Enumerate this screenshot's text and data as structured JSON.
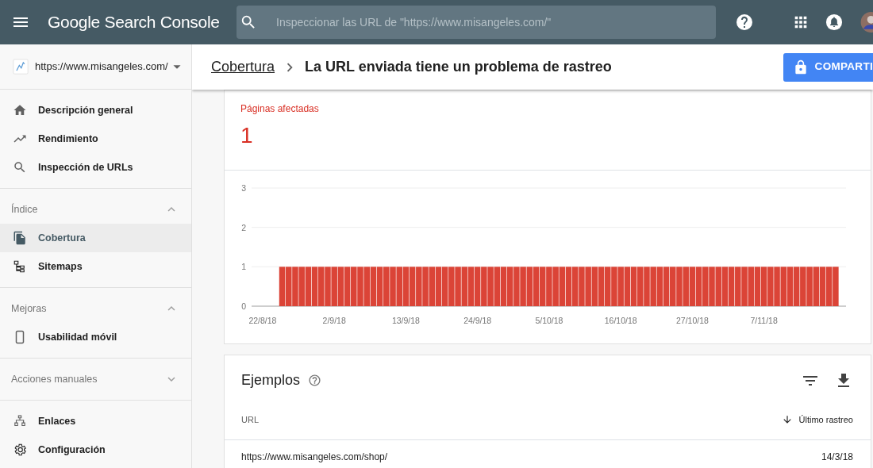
{
  "app": {
    "title": "Google Search Console"
  },
  "search": {
    "placeholder": "Inspeccionar las URL de \"https://www.misangeles.com/\""
  },
  "sidebar": {
    "property": "https://www.misangeles.com/",
    "sections": [
      {
        "items": [
          {
            "label": "Descripción general",
            "selected": false
          },
          {
            "label": "Rendimiento",
            "selected": false
          },
          {
            "label": "Inspección de URLs",
            "selected": false
          }
        ]
      },
      {
        "heading": "Índice",
        "expanded": true,
        "items": [
          {
            "label": "Cobertura",
            "selected": true
          },
          {
            "label": "Sitemaps",
            "selected": false
          }
        ]
      },
      {
        "heading": "Mejoras",
        "expanded": true,
        "items": [
          {
            "label": "Usabilidad móvil",
            "selected": false
          }
        ]
      },
      {
        "heading": "Acciones manuales",
        "expanded": false
      },
      {
        "items": [
          {
            "label": "Enlaces",
            "selected": false
          },
          {
            "label": "Configuración",
            "selected": false
          }
        ]
      }
    ]
  },
  "header": {
    "breadcrumb": "Cobertura",
    "title": "La URL enviada tiene un problema de rastreo",
    "share_button": "COMPARTI"
  },
  "summary": {
    "label": "Páginas afectadas",
    "value": "1",
    "chart_data": {
      "type": "bar",
      "categories": [
        "22/8/18",
        null,
        null,
        null,
        null,
        null,
        null,
        null,
        null,
        null,
        null,
        "2/9/18",
        null,
        null,
        null,
        null,
        null,
        null,
        null,
        null,
        null,
        null,
        "13/9/18",
        null,
        null,
        null,
        null,
        null,
        null,
        null,
        null,
        null,
        null,
        "24/9/18",
        null,
        null,
        null,
        null,
        null,
        null,
        null,
        null,
        null,
        null,
        "5/10/18",
        null,
        null,
        null,
        null,
        null,
        null,
        null,
        null,
        null,
        null,
        "16/10/18",
        null,
        null,
        null,
        null,
        null,
        null,
        null,
        null,
        null,
        null,
        "27/10/18",
        null,
        null,
        null,
        null,
        null,
        null,
        null,
        null,
        null,
        null,
        "7/11/18",
        null,
        null,
        null,
        null,
        null,
        null,
        null,
        null,
        null,
        null,
        null
      ],
      "series": [
        {
          "color": "#db4437",
          "values": [
            0,
            0,
            0,
            1,
            1,
            1,
            1,
            1,
            1,
            1,
            1,
            1,
            1,
            1,
            1,
            1,
            1,
            1,
            1,
            1,
            1,
            1,
            1,
            1,
            1,
            1,
            1,
            1,
            1,
            1,
            1,
            1,
            1,
            1,
            1,
            1,
            1,
            1,
            1,
            1,
            1,
            1,
            1,
            1,
            1,
            1,
            1,
            1,
            1,
            1,
            1,
            1,
            1,
            1,
            1,
            1,
            1,
            1,
            1,
            1,
            1,
            1,
            1,
            1,
            1,
            1,
            1,
            1,
            1,
            1,
            1,
            1,
            1,
            1,
            1,
            1,
            1,
            1,
            1,
            1,
            1,
            1,
            1,
            1,
            1,
            1,
            1,
            1,
            1
          ]
        }
      ],
      "ylim": [
        0,
        3
      ],
      "yticks": [
        0,
        1,
        2,
        3
      ]
    }
  },
  "examples": {
    "title": "Ejemplos",
    "columns": [
      "URL",
      "Último rastreo"
    ],
    "rows": [
      [
        "https://www.misangeles.com/shop/",
        "14/3/18"
      ]
    ]
  }
}
